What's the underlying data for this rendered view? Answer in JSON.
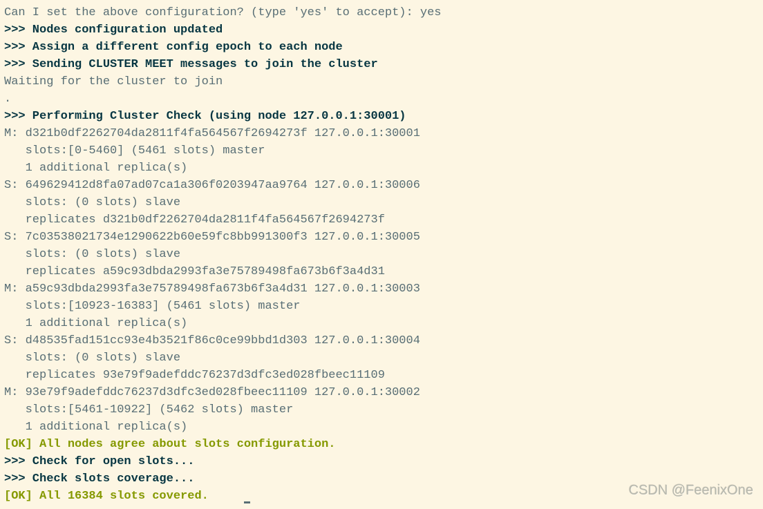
{
  "terminal": {
    "prompt_q": "Can I set the above configuration? (type 'yes' to accept): yes",
    "msg_nodes_updated": ">>> Nodes configuration updated",
    "msg_assign_epoch": ">>> Assign a different config epoch to each node",
    "msg_send_meet": ">>> Sending CLUSTER MEET messages to join the cluster",
    "waiting": "Waiting for the cluster to join",
    "dot": ".",
    "msg_perform_check": ">>> Performing Cluster Check (using node 127.0.0.1:30001)",
    "node_m1_l1": "M: d321b0df2262704da2811f4fa564567f2694273f 127.0.0.1:30001",
    "node_m1_l2": "   slots:[0-5460] (5461 slots) master",
    "node_m1_l3": "   1 additional replica(s)",
    "node_s1_l1": "S: 649629412d8fa07ad07ca1a306f0203947aa9764 127.0.0.1:30006",
    "node_s1_l2": "   slots: (0 slots) slave",
    "node_s1_l3": "   replicates d321b0df2262704da2811f4fa564567f2694273f",
    "node_s2_l1": "S: 7c03538021734e1290622b60e59fc8bb991300f3 127.0.0.1:30005",
    "node_s2_l2": "   slots: (0 slots) slave",
    "node_s2_l3": "   replicates a59c93dbda2993fa3e75789498fa673b6f3a4d31",
    "node_m2_l1": "M: a59c93dbda2993fa3e75789498fa673b6f3a4d31 127.0.0.1:30003",
    "node_m2_l2": "   slots:[10923-16383] (5461 slots) master",
    "node_m2_l3": "   1 additional replica(s)",
    "node_s3_l1": "S: d48535fad151cc93e4b3521f86c0ce99bbd1d303 127.0.0.1:30004",
    "node_s3_l2": "   slots: (0 slots) slave",
    "node_s3_l3": "   replicates 93e79f9adefddc76237d3dfc3ed028fbeec11109",
    "node_m3_l1": "M: 93e79f9adefddc76237d3dfc3ed028fbeec11109 127.0.0.1:30002",
    "node_m3_l2": "   slots:[5461-10922] (5462 slots) master",
    "node_m3_l3": "   1 additional replica(s)",
    "ok_agree": "[OK] All nodes agree about slots configuration.",
    "check_open": ">>> Check for open slots...",
    "check_cov": ">>> Check slots coverage...",
    "ok_cov": "[OK] All 16384 slots covered."
  },
  "watermark": "CSDN @FeenixOne"
}
